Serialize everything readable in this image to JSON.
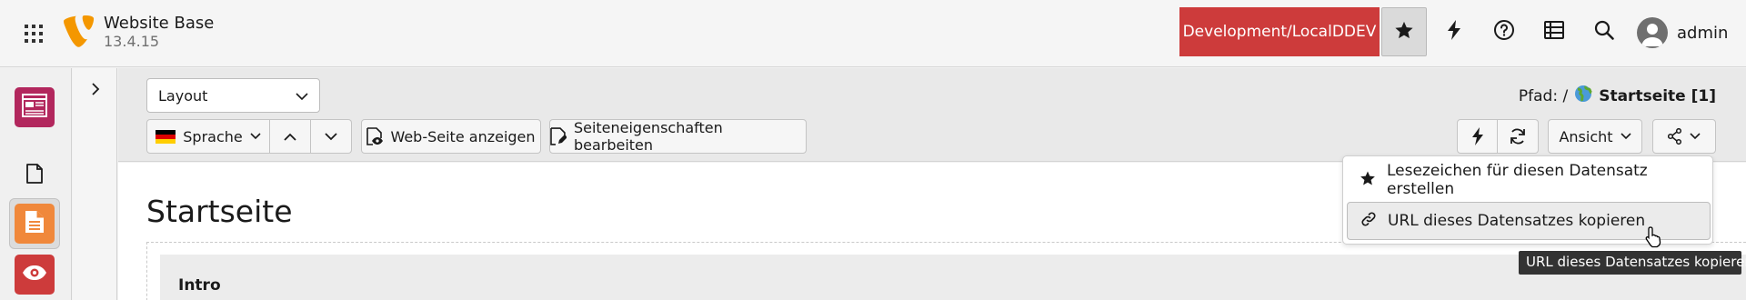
{
  "topbar": {
    "site_name": "Website Base",
    "site_version": "13.4.15",
    "environment": "Development/LocalDDEV",
    "user_name": "admin",
    "colors": {
      "environment_badge": "#cd3b3b",
      "logo": "#f49700"
    }
  },
  "modulemenu": {
    "colors": {
      "page": "#b2275d",
      "layout": "#f0883b",
      "view": "#cd3b3b"
    }
  },
  "docheader": {
    "layout_select": "Layout",
    "language_button": "Sprache",
    "view_page_button": "Web-Seite anzeigen",
    "edit_props_button": "Seiteneigenschaften bearbeiten",
    "path_label": "Pfad: /",
    "path_page": "Startseite [1]",
    "view_button": "Ansicht"
  },
  "content": {
    "page_title": "Startseite",
    "column_title": "Intro"
  },
  "share_menu": {
    "items": [
      {
        "label": "Lesezeichen für diesen Datensatz erstellen",
        "icon": "star-icon"
      },
      {
        "label": "URL dieses Datensatzes kopieren",
        "icon": "link-icon"
      }
    ],
    "tooltip": "URL dieses Datensatzes kopieren"
  }
}
